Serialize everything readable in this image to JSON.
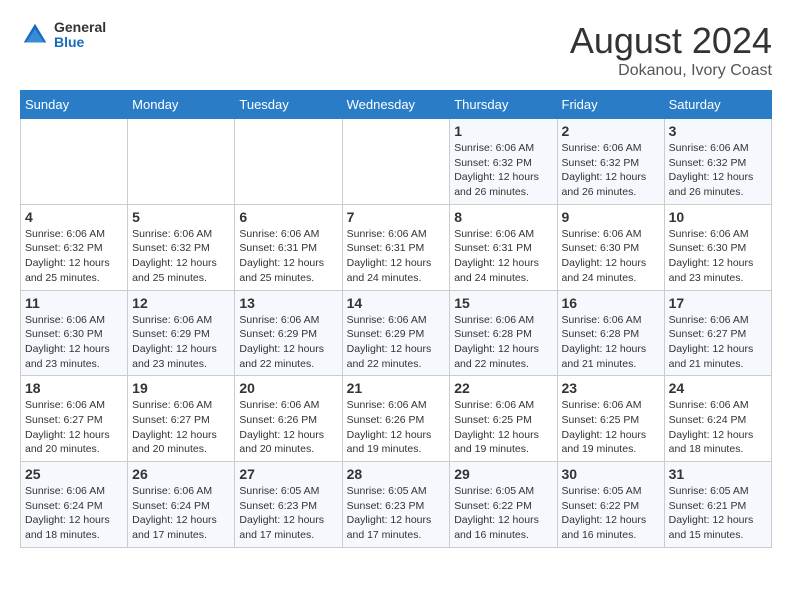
{
  "header": {
    "logo_general": "General",
    "logo_blue": "Blue",
    "title": "August 2024",
    "subtitle": "Dokanou, Ivory Coast"
  },
  "weekdays": [
    "Sunday",
    "Monday",
    "Tuesday",
    "Wednesday",
    "Thursday",
    "Friday",
    "Saturday"
  ],
  "weeks": [
    [
      {
        "day": "",
        "info": ""
      },
      {
        "day": "",
        "info": ""
      },
      {
        "day": "",
        "info": ""
      },
      {
        "day": "",
        "info": ""
      },
      {
        "day": "1",
        "info": "Sunrise: 6:06 AM\nSunset: 6:32 PM\nDaylight: 12 hours\nand 26 minutes."
      },
      {
        "day": "2",
        "info": "Sunrise: 6:06 AM\nSunset: 6:32 PM\nDaylight: 12 hours\nand 26 minutes."
      },
      {
        "day": "3",
        "info": "Sunrise: 6:06 AM\nSunset: 6:32 PM\nDaylight: 12 hours\nand 26 minutes."
      }
    ],
    [
      {
        "day": "4",
        "info": "Sunrise: 6:06 AM\nSunset: 6:32 PM\nDaylight: 12 hours\nand 25 minutes."
      },
      {
        "day": "5",
        "info": "Sunrise: 6:06 AM\nSunset: 6:32 PM\nDaylight: 12 hours\nand 25 minutes."
      },
      {
        "day": "6",
        "info": "Sunrise: 6:06 AM\nSunset: 6:31 PM\nDaylight: 12 hours\nand 25 minutes."
      },
      {
        "day": "7",
        "info": "Sunrise: 6:06 AM\nSunset: 6:31 PM\nDaylight: 12 hours\nand 24 minutes."
      },
      {
        "day": "8",
        "info": "Sunrise: 6:06 AM\nSunset: 6:31 PM\nDaylight: 12 hours\nand 24 minutes."
      },
      {
        "day": "9",
        "info": "Sunrise: 6:06 AM\nSunset: 6:30 PM\nDaylight: 12 hours\nand 24 minutes."
      },
      {
        "day": "10",
        "info": "Sunrise: 6:06 AM\nSunset: 6:30 PM\nDaylight: 12 hours\nand 23 minutes."
      }
    ],
    [
      {
        "day": "11",
        "info": "Sunrise: 6:06 AM\nSunset: 6:30 PM\nDaylight: 12 hours\nand 23 minutes."
      },
      {
        "day": "12",
        "info": "Sunrise: 6:06 AM\nSunset: 6:29 PM\nDaylight: 12 hours\nand 23 minutes."
      },
      {
        "day": "13",
        "info": "Sunrise: 6:06 AM\nSunset: 6:29 PM\nDaylight: 12 hours\nand 22 minutes."
      },
      {
        "day": "14",
        "info": "Sunrise: 6:06 AM\nSunset: 6:29 PM\nDaylight: 12 hours\nand 22 minutes."
      },
      {
        "day": "15",
        "info": "Sunrise: 6:06 AM\nSunset: 6:28 PM\nDaylight: 12 hours\nand 22 minutes."
      },
      {
        "day": "16",
        "info": "Sunrise: 6:06 AM\nSunset: 6:28 PM\nDaylight: 12 hours\nand 21 minutes."
      },
      {
        "day": "17",
        "info": "Sunrise: 6:06 AM\nSunset: 6:27 PM\nDaylight: 12 hours\nand 21 minutes."
      }
    ],
    [
      {
        "day": "18",
        "info": "Sunrise: 6:06 AM\nSunset: 6:27 PM\nDaylight: 12 hours\nand 20 minutes."
      },
      {
        "day": "19",
        "info": "Sunrise: 6:06 AM\nSunset: 6:27 PM\nDaylight: 12 hours\nand 20 minutes."
      },
      {
        "day": "20",
        "info": "Sunrise: 6:06 AM\nSunset: 6:26 PM\nDaylight: 12 hours\nand 20 minutes."
      },
      {
        "day": "21",
        "info": "Sunrise: 6:06 AM\nSunset: 6:26 PM\nDaylight: 12 hours\nand 19 minutes."
      },
      {
        "day": "22",
        "info": "Sunrise: 6:06 AM\nSunset: 6:25 PM\nDaylight: 12 hours\nand 19 minutes."
      },
      {
        "day": "23",
        "info": "Sunrise: 6:06 AM\nSunset: 6:25 PM\nDaylight: 12 hours\nand 19 minutes."
      },
      {
        "day": "24",
        "info": "Sunrise: 6:06 AM\nSunset: 6:24 PM\nDaylight: 12 hours\nand 18 minutes."
      }
    ],
    [
      {
        "day": "25",
        "info": "Sunrise: 6:06 AM\nSunset: 6:24 PM\nDaylight: 12 hours\nand 18 minutes."
      },
      {
        "day": "26",
        "info": "Sunrise: 6:06 AM\nSunset: 6:24 PM\nDaylight: 12 hours\nand 17 minutes."
      },
      {
        "day": "27",
        "info": "Sunrise: 6:05 AM\nSunset: 6:23 PM\nDaylight: 12 hours\nand 17 minutes."
      },
      {
        "day": "28",
        "info": "Sunrise: 6:05 AM\nSunset: 6:23 PM\nDaylight: 12 hours\nand 17 minutes."
      },
      {
        "day": "29",
        "info": "Sunrise: 6:05 AM\nSunset: 6:22 PM\nDaylight: 12 hours\nand 16 minutes."
      },
      {
        "day": "30",
        "info": "Sunrise: 6:05 AM\nSunset: 6:22 PM\nDaylight: 12 hours\nand 16 minutes."
      },
      {
        "day": "31",
        "info": "Sunrise: 6:05 AM\nSunset: 6:21 PM\nDaylight: 12 hours\nand 15 minutes."
      }
    ]
  ]
}
